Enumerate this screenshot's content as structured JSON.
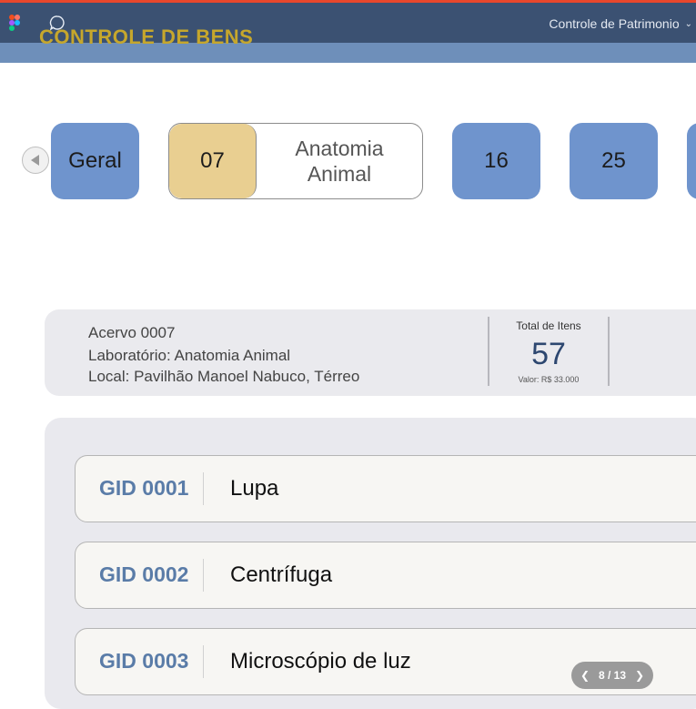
{
  "app": {
    "title": "CONTROLE DE BENS",
    "file_name": "Controle de Patrimonio"
  },
  "tabs": {
    "general": "Geral",
    "active_number": "07",
    "active_name": "Anatomia Animal",
    "others": [
      "16",
      "25"
    ]
  },
  "info": {
    "acervo": "Acervo 0007",
    "laboratorio": "Laboratório: Anatomia Animal",
    "local": "Local: Pavilhão Manoel Nabuco, Térreo",
    "total_label": "Total de Itens",
    "total_value": "57",
    "valor": "Valor: R$ 33.000"
  },
  "items": [
    {
      "gid": "GID 0001",
      "name": "Lupa"
    },
    {
      "gid": "GID 0002",
      "name": "Centrífuga"
    },
    {
      "gid": "GID 0003",
      "name": "Microscópio de luz"
    }
  ],
  "pager": {
    "label": "8 / 13"
  },
  "colors": {
    "topbar": "#3b5172",
    "accent_title": "#c6a72c",
    "tab_blue": "#6f94cd",
    "tab_active": "#e9cf91",
    "gid_text": "#5a7ca8"
  },
  "icons": [
    "figma-icon",
    "comment-icon",
    "chevron-down-icon",
    "arrow-left-icon",
    "chevron-left-icon",
    "chevron-right-icon"
  ]
}
